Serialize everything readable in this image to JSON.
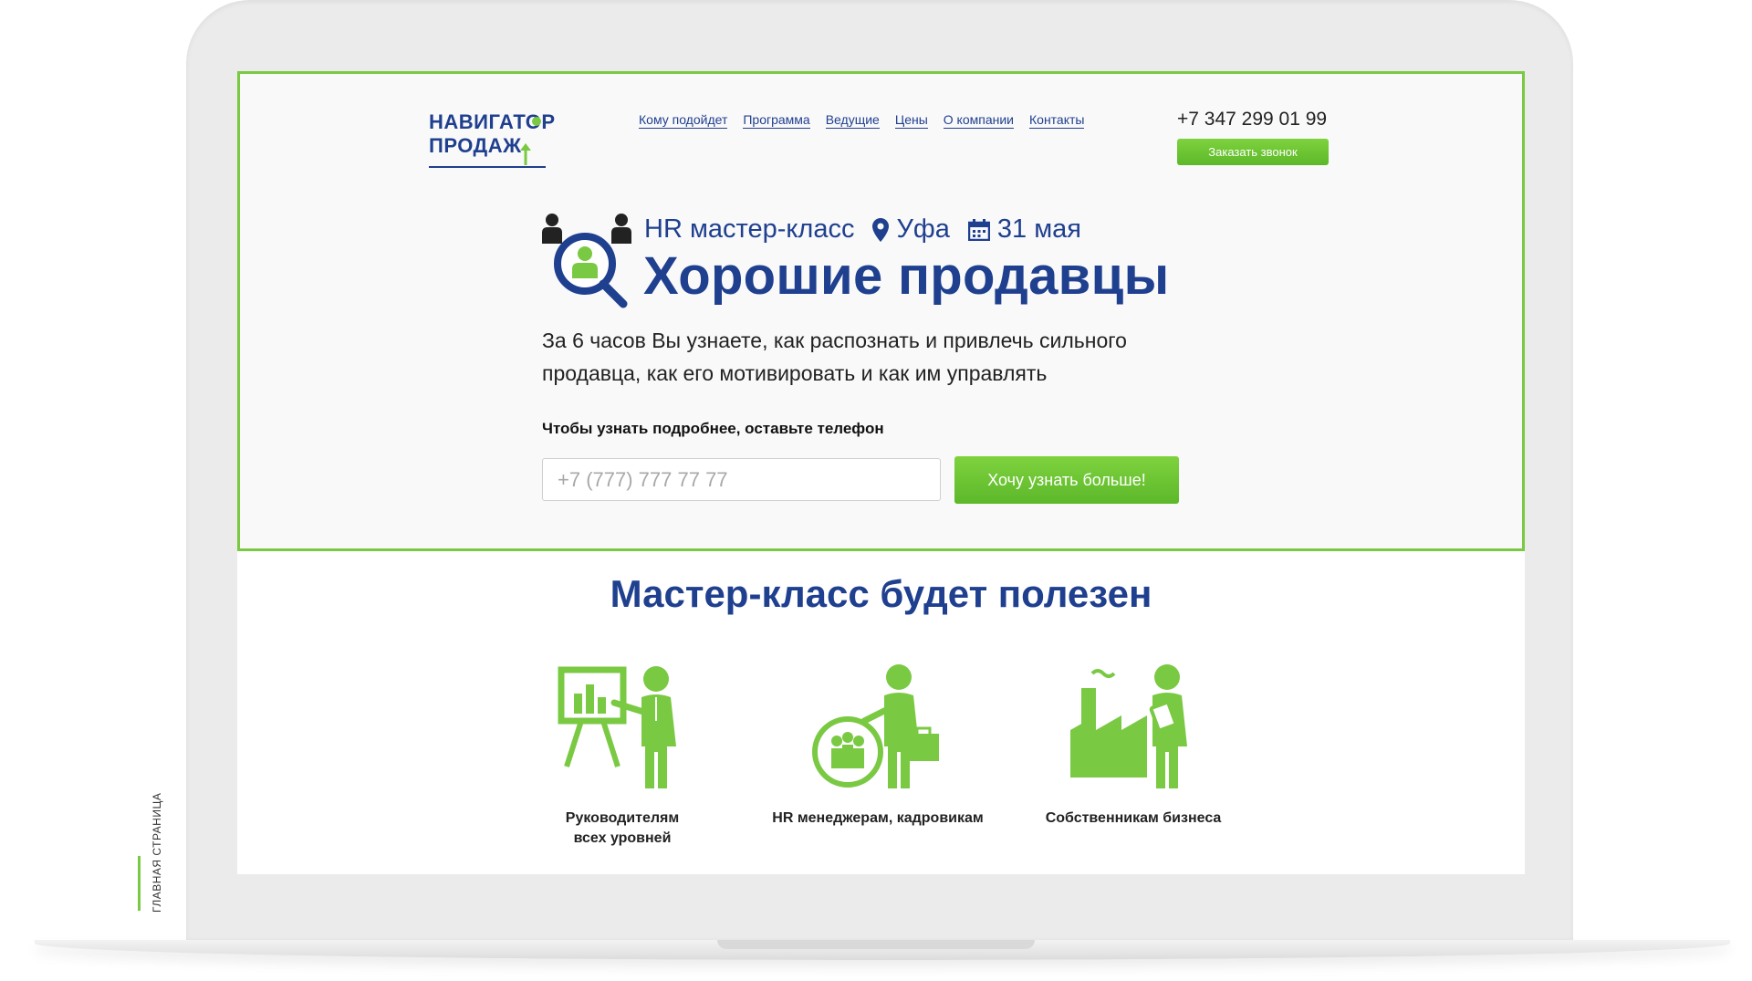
{
  "header": {
    "logo": {
      "line1": "НАВИГАТОР",
      "line2": "ПРОДАЖ"
    },
    "nav": [
      {
        "label": "Кому подойдет"
      },
      {
        "label": "Программа"
      },
      {
        "label": "Ведущие"
      },
      {
        "label": "Цены"
      },
      {
        "label": "О компании"
      },
      {
        "label": "Контакты"
      }
    ],
    "phone": "+7 347 299 01 99",
    "callback_label": "Заказать звонок"
  },
  "hero": {
    "event_type": "HR мастер-класс",
    "city": "Уфа",
    "date": "31 мая",
    "title": "Хорошие продавцы",
    "subtitle": "За 6 часов Вы узнаете, как распознать и привлечь сильного продавца, как его мотивировать и как им управлять",
    "form_label": "Чтобы узнать подробнее, оставьте телефон",
    "phone_placeholder": "+7 (777) 777 77 77",
    "cta_label": "Хочу узнать больше!"
  },
  "audience": {
    "title": "Мастер-класс будет полезен",
    "items": [
      {
        "line1": "Руководителям",
        "line2": "всех уровней",
        "icon": "presenter-icon"
      },
      {
        "line1": "HR менеджерам, кадровикам",
        "line2": "",
        "icon": "hr-manager-icon"
      },
      {
        "line1": "Собственникам бизнеса",
        "line2": "",
        "icon": "factory-owner-icon"
      }
    ]
  },
  "side_caption": "ГЛАВНАЯ СТРАНИЦА",
  "colors": {
    "brand_blue": "#1f3f8f",
    "accent_green": "#7ac943"
  }
}
